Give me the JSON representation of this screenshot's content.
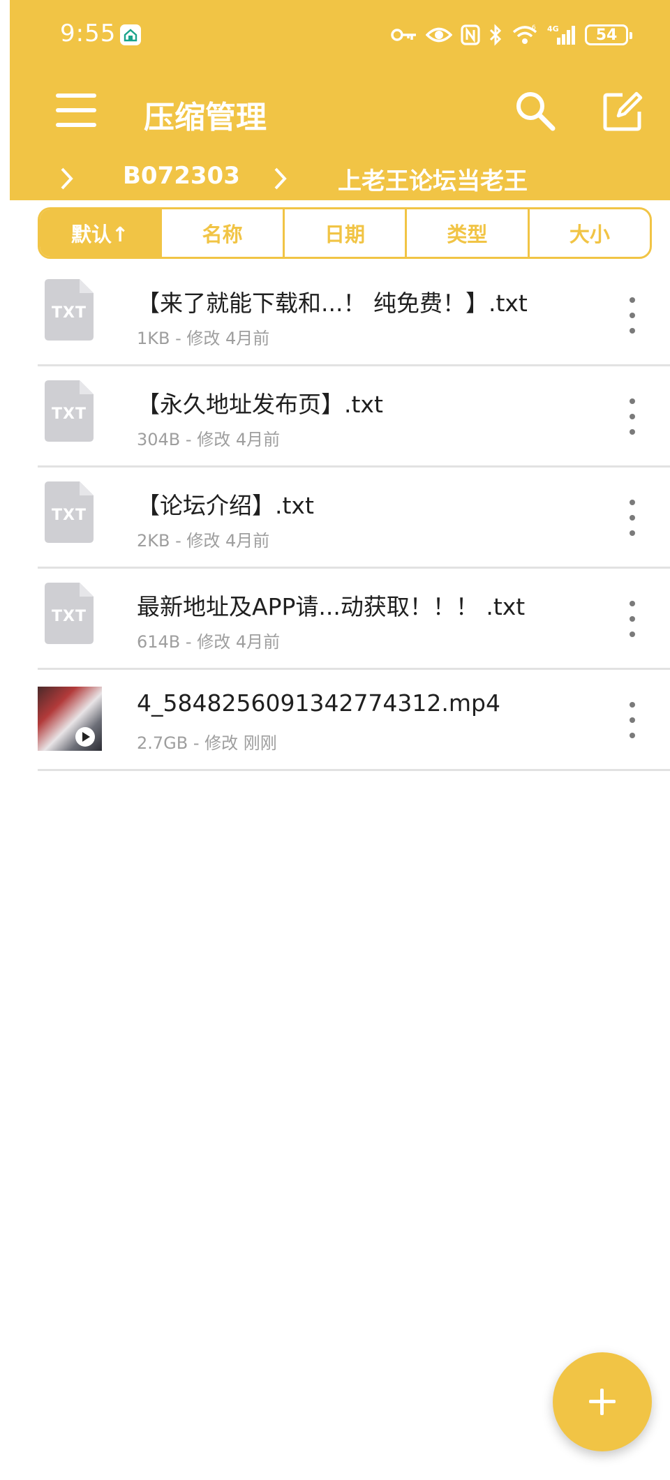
{
  "status_bar": {
    "time": "9:55",
    "battery": "54",
    "icons": [
      "home-app-icon",
      "key-icon",
      "eye-icon",
      "nfc-icon",
      "bluetooth-icon",
      "wifi-icon",
      "signal-4g-icon",
      "battery-icon"
    ]
  },
  "toolbar": {
    "title": "压缩管理",
    "icons": [
      "menu-icon",
      "search-icon",
      "edit-icon"
    ]
  },
  "breadcrumb": {
    "items": [
      "B072303",
      "上老王论坛当老王"
    ]
  },
  "sort_tabs": [
    {
      "label": "默认↑",
      "active": true
    },
    {
      "label": "名称",
      "active": false
    },
    {
      "label": "日期",
      "active": false
    },
    {
      "label": "类型",
      "active": false
    },
    {
      "label": "大小",
      "active": false
    }
  ],
  "files": [
    {
      "name": "【来了就能下载和...！ 纯免费！】.txt",
      "meta": "1KB - 修改 4月前",
      "type": "TXT"
    },
    {
      "name": "【永久地址发布页】.txt",
      "meta": "304B - 修改 4月前",
      "type": "TXT"
    },
    {
      "name": "【论坛介绍】.txt",
      "meta": "2KB - 修改 4月前",
      "type": "TXT"
    },
    {
      "name": "最新地址及APP请...动获取！！！ .txt",
      "meta": "614B - 修改 4月前",
      "type": "TXT"
    },
    {
      "name": "4_5848256091342774312.mp4",
      "meta": "2.7GB - 修改 刚刚",
      "type": "video"
    }
  ],
  "colors": {
    "accent": "#f1c445",
    "file_icon_gray": "#cfcfd3",
    "divider": "#e2e2e2",
    "meta_text": "#9e9e9e"
  }
}
